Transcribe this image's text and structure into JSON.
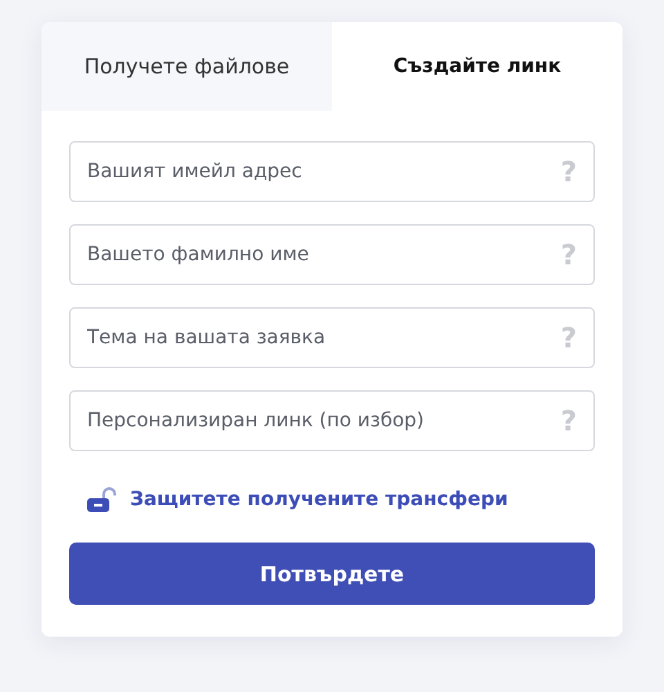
{
  "tabs": [
    {
      "label": "Получете файлове",
      "selected": false
    },
    {
      "label": "Създайте линк",
      "selected": true
    }
  ],
  "fields": [
    {
      "placeholder": "Вашият имейл адрес",
      "help": "?"
    },
    {
      "placeholder": "Вашето фамилно име",
      "help": "?"
    },
    {
      "placeholder": "Тема на вашата заявка",
      "help": "?"
    },
    {
      "placeholder": "Персонализиран линк (по избор)",
      "help": "?"
    }
  ],
  "protect_link": {
    "label": "Защитете получените трансфери",
    "locked": false
  },
  "submit_button": "Потвърдете"
}
